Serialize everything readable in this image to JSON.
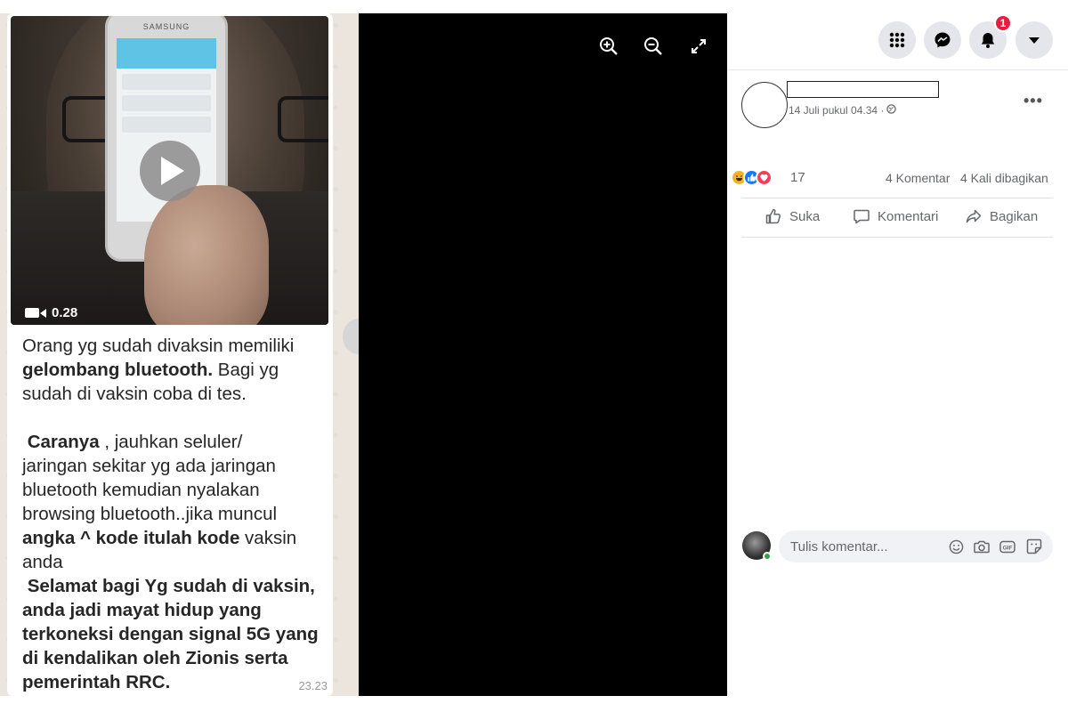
{
  "whatsapp": {
    "video_duration": "0.28",
    "phone_brand": "SAMSUNG",
    "message_paragraphs": [
      [
        {
          "text": "Orang yg sudah divaksin memiliki\n",
          "bold": false
        },
        {
          "text": "gelombang bluetooth.",
          "bold": true
        },
        {
          "text": " Bagi yg\nsudah di vaksin coba di tes.\n\n ",
          "bold": false
        },
        {
          "text": "Caranya",
          "bold": true
        },
        {
          "text": " , jauhkan seluler/\njaringan sekitar yg ada jaringan\nbluetooth kemudian nyalakan\nbrowsing bluetooth..jika muncul\n",
          "bold": false
        },
        {
          "text": "angka ^ kode itulah kode",
          "bold": true
        },
        {
          "text": " vaksin\nanda\n ",
          "bold": false
        },
        {
          "text": "Selamat bagi Yg sudah di vaksin,\nanda jadi mayat hidup yang\nterkoneksi dengan signal 5G yang\ndi kendalikan oleh Zionis serta\npemerintah RRC.",
          "bold": true
        }
      ]
    ],
    "timestamp": "23.23"
  },
  "viewer": {
    "zoom_in_icon": "zoom-in-icon",
    "zoom_out_icon": "zoom-out-icon",
    "fullscreen_icon": "fullscreen-icon"
  },
  "facebook": {
    "topbar": {
      "menu_icon": "grid-menu-icon",
      "messenger_icon": "messenger-icon",
      "notifications_icon": "bell-icon",
      "notification_count": "1",
      "account_icon": "caret-down-icon"
    },
    "post": {
      "date": "14 Juli pukul 04.34 ·",
      "privacy_icon": "globe-icon",
      "reactions": [
        "haha",
        "like",
        "love"
      ],
      "reaction_count": "17",
      "comments": "4 Komentar",
      "shares": "4 Kali dibagikan",
      "actions": {
        "like": "Suka",
        "comment": "Komentari",
        "share": "Bagikan"
      }
    },
    "comment_box": {
      "placeholder": "Tulis komentar...",
      "icons": [
        "emoji-icon",
        "camera-icon",
        "gif-icon",
        "sticker-icon"
      ]
    },
    "colors": {
      "accent": "#1877f2",
      "love": "#f33e58",
      "haha": "#f7b125",
      "badge": "#e41e3f"
    }
  }
}
